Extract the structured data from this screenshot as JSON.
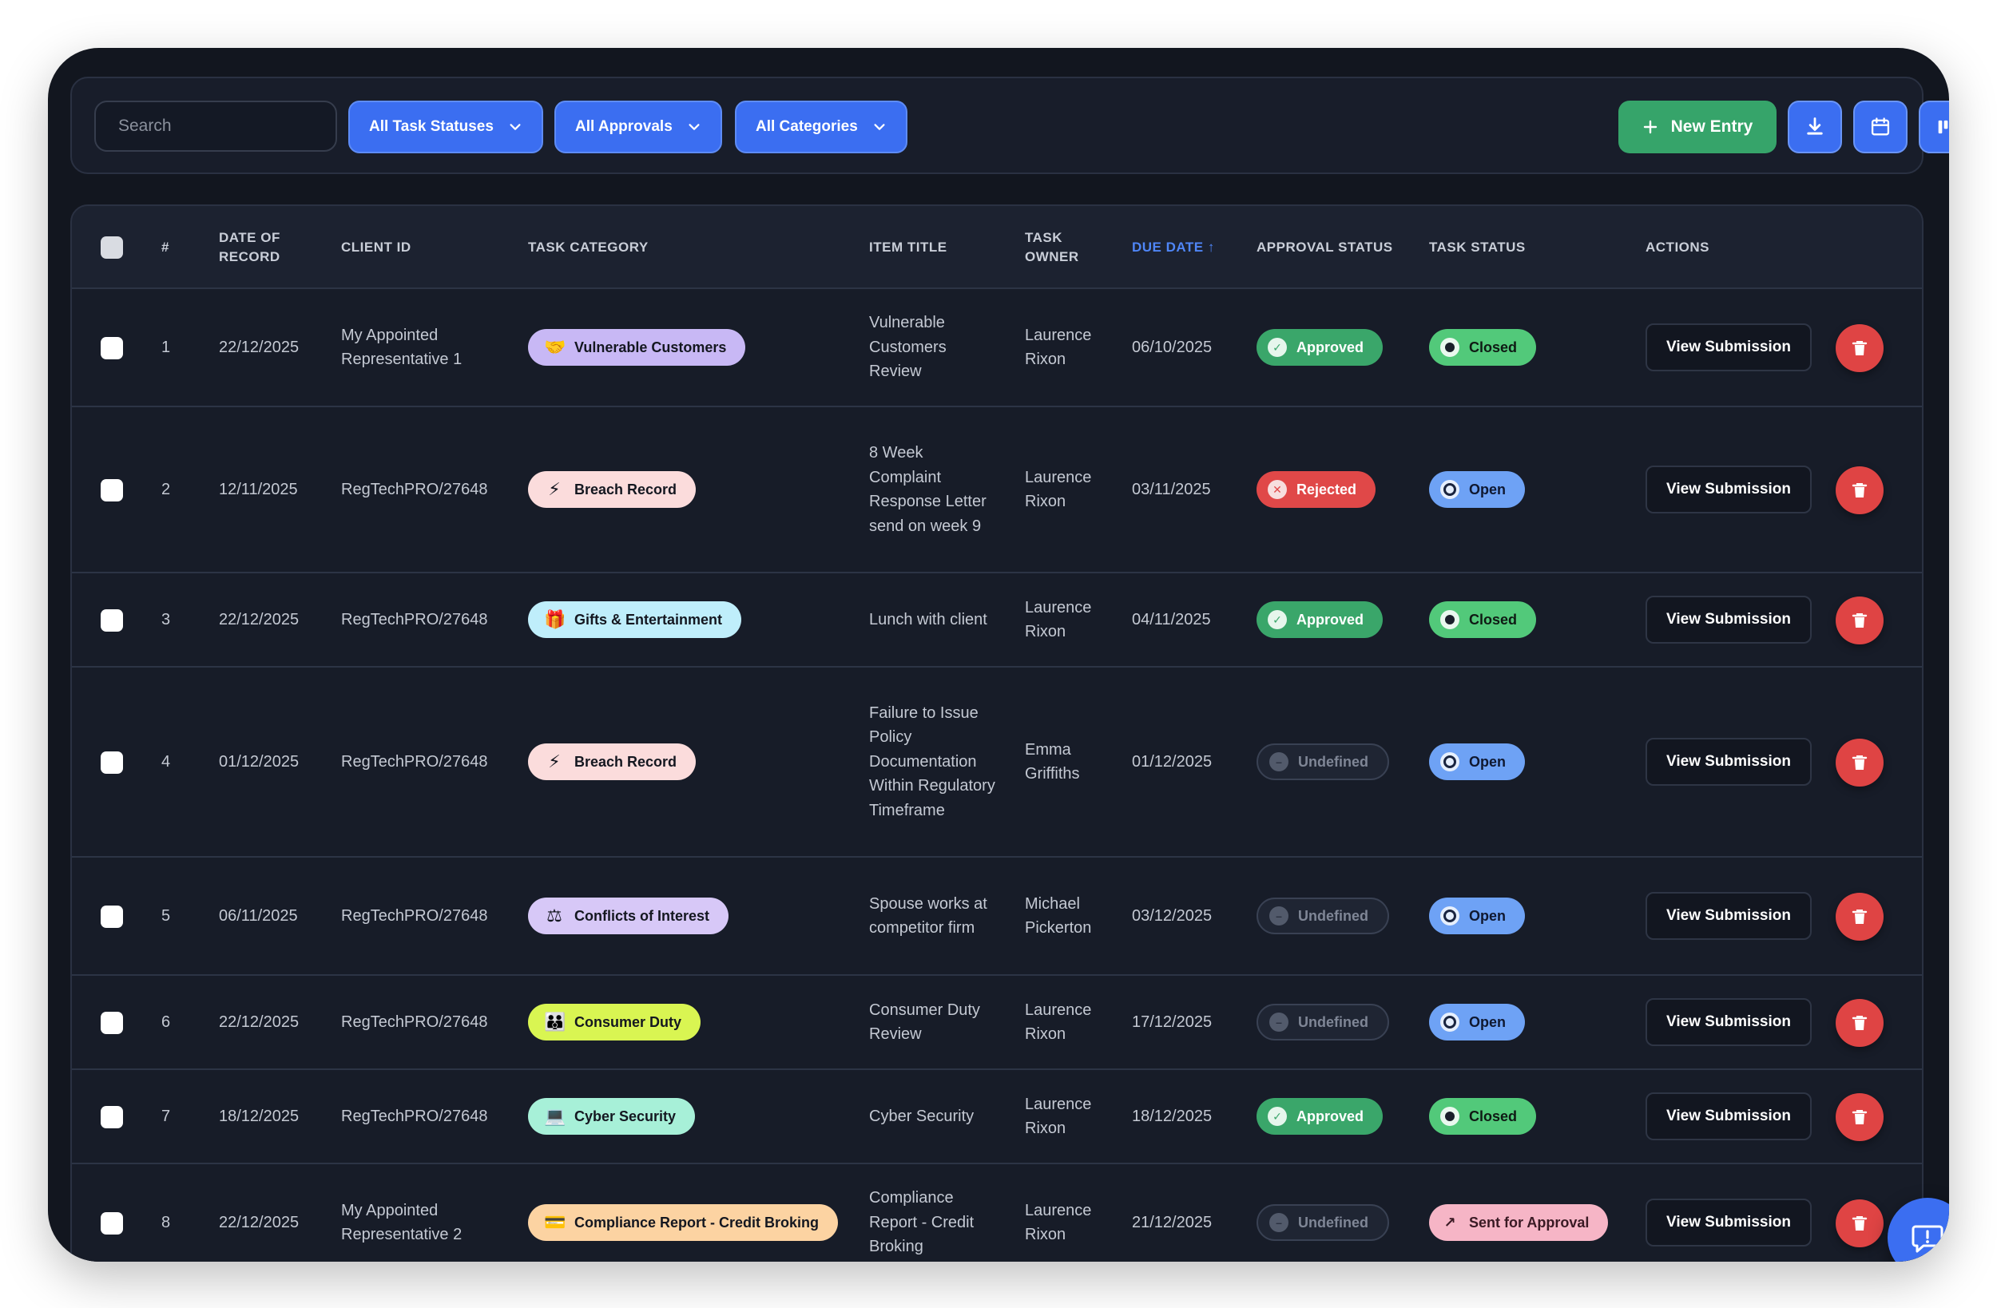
{
  "toolbar": {
    "search_placeholder": "Search",
    "filter_status": "All Task Statuses",
    "filter_approvals": "All Approvals",
    "filter_categories": "All Categories",
    "new_entry": "New Entry",
    "icons": [
      "download-icon",
      "calendar-icon",
      "kanban-icon"
    ]
  },
  "table": {
    "headers": {
      "num": "#",
      "date": "DATE OF RECORD",
      "client": "CLIENT ID",
      "category": "TASK CATEGORY",
      "title": "ITEM TITLE",
      "owner": "TASK OWNER",
      "due": "DUE DATE ↑",
      "approval": "APPROVAL STATUS",
      "status": "TASK STATUS",
      "actions": "ACTIONS"
    },
    "view_label": "View Submission",
    "rows": [
      {
        "num": "1",
        "date": "22/12/2025",
        "client": "My Appointed Representative 1",
        "category": "Vulnerable Customers",
        "cat_icon": "🤝",
        "cat_color": "#c8b8f5",
        "title": "Vulnerable Customers Review",
        "owner": "Laurence Rixon",
        "due": "06/10/2025",
        "approval": "Approved",
        "approval_kind": "approved",
        "status": "Closed",
        "status_kind": "closed"
      },
      {
        "num": "2",
        "date": "12/11/2025",
        "client": "RegTechPRO/27648",
        "category": "Breach Record",
        "cat_icon": "⚡",
        "cat_color": "#fbdcdc",
        "title": "8 Week Complaint Response Letter send on week 9",
        "owner": "Laurence Rixon",
        "due": "03/11/2025",
        "approval": "Rejected",
        "approval_kind": "rejected",
        "status": "Open",
        "status_kind": "open"
      },
      {
        "num": "3",
        "date": "22/12/2025",
        "client": "RegTechPRO/27648",
        "category": "Gifts & Entertainment",
        "cat_icon": "🎁",
        "cat_color": "#bfeefb",
        "title": "Lunch with client",
        "owner": "Laurence Rixon",
        "due": "04/11/2025",
        "approval": "Approved",
        "approval_kind": "approved",
        "status": "Closed",
        "status_kind": "closed"
      },
      {
        "num": "4",
        "date": "01/12/2025",
        "client": "RegTechPRO/27648",
        "category": "Breach Record",
        "cat_icon": "⚡",
        "cat_color": "#fbdcdc",
        "title": "Failure to Issue Policy Documentation Within Regulatory Timeframe",
        "owner": "Emma Griffiths",
        "due": "01/12/2025",
        "approval": "Undefined",
        "approval_kind": "undef",
        "status": "Open",
        "status_kind": "open"
      },
      {
        "num": "5",
        "date": "06/11/2025",
        "client": "RegTechPRO/27648",
        "category": "Conflicts of Interest",
        "cat_icon": "⚖",
        "cat_color": "#d7c8f7",
        "title": "Spouse works at competitor firm",
        "owner": "Michael Pickerton",
        "due": "03/12/2025",
        "approval": "Undefined",
        "approval_kind": "undef",
        "status": "Open",
        "status_kind": "open"
      },
      {
        "num": "6",
        "date": "22/12/2025",
        "client": "RegTechPRO/27648",
        "category": "Consumer Duty",
        "cat_icon": "👪",
        "cat_color": "#d9f552",
        "title": "Consumer Duty Review",
        "owner": "Laurence Rixon",
        "due": "17/12/2025",
        "approval": "Undefined",
        "approval_kind": "undef",
        "status": "Open",
        "status_kind": "open"
      },
      {
        "num": "7",
        "date": "18/12/2025",
        "client": "RegTechPRO/27648",
        "category": "Cyber Security",
        "cat_icon": "💻",
        "cat_color": "#a7f0d8",
        "title": "Cyber Security",
        "owner": "Laurence Rixon",
        "due": "18/12/2025",
        "approval": "Approved",
        "approval_kind": "approved",
        "status": "Closed",
        "status_kind": "closed"
      },
      {
        "num": "8",
        "date": "22/12/2025",
        "client": "My Appointed Representative 2",
        "category": "Compliance Report - Credit Broking",
        "cat_icon": "💳",
        "cat_color": "#fcd3a2",
        "title": "Compliance Report - Credit Broking",
        "owner": "Laurence Rixon",
        "due": "21/12/2025",
        "approval": "Undefined",
        "approval_kind": "undef",
        "status": "Sent for Approval",
        "status_kind": "sent"
      }
    ]
  }
}
